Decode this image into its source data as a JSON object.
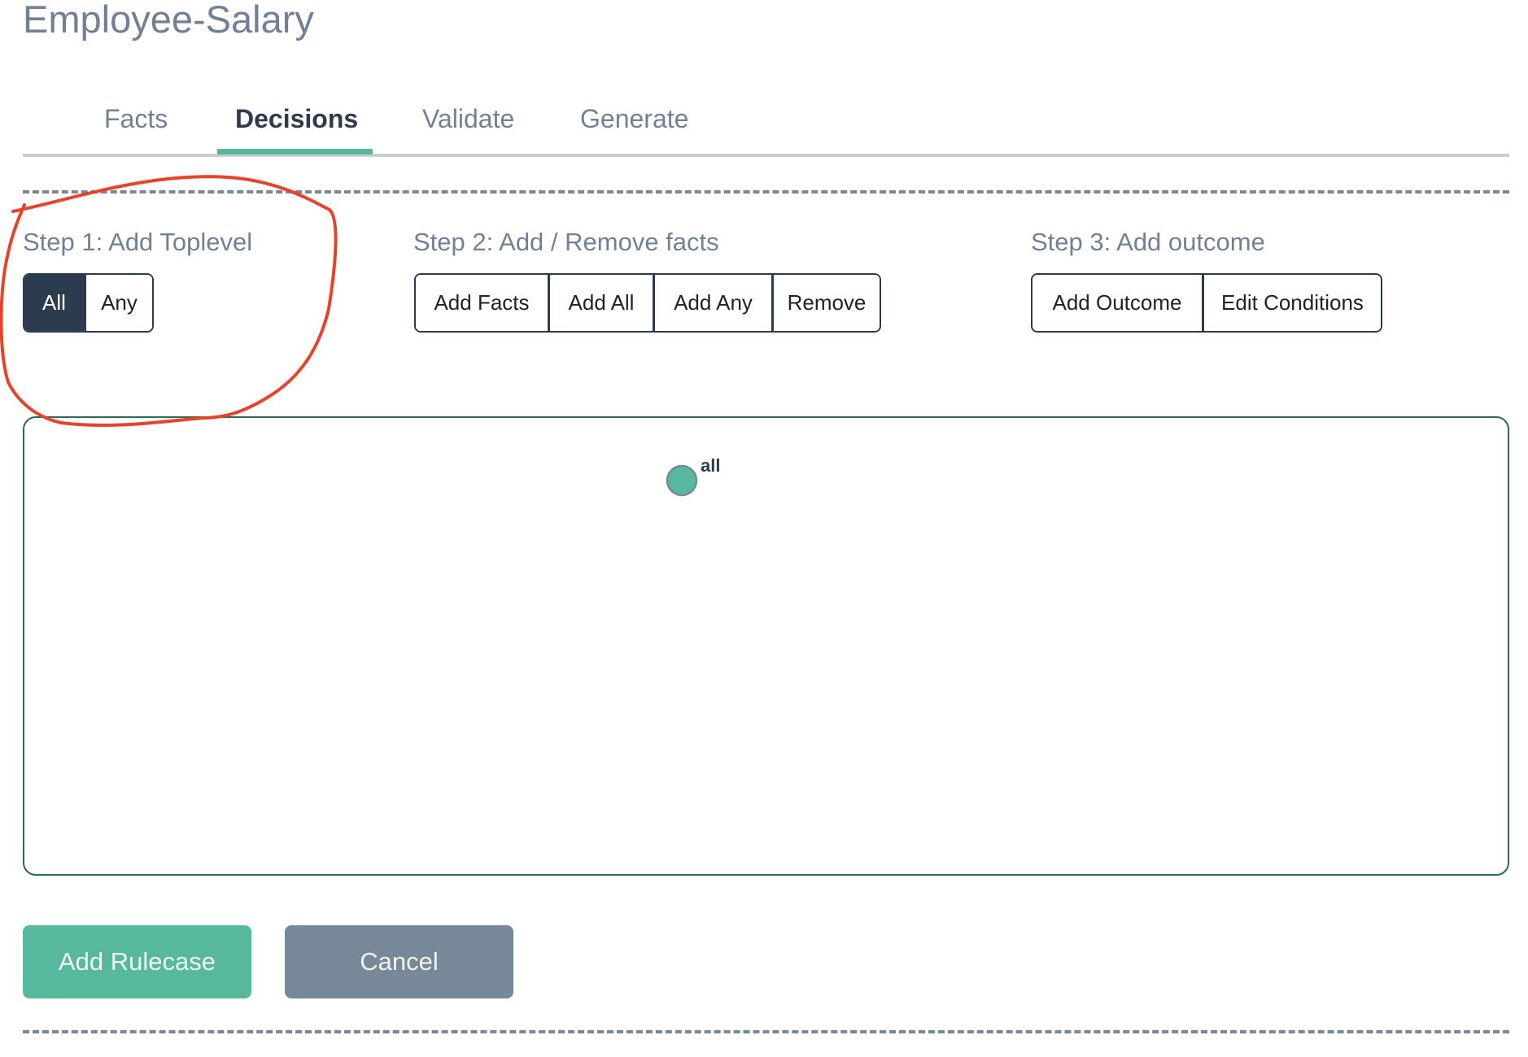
{
  "header": {
    "title": "Employee-Salary"
  },
  "tabs": [
    {
      "label": "Facts",
      "active": false
    },
    {
      "label": "Decisions",
      "active": true
    },
    {
      "label": "Validate",
      "active": false
    },
    {
      "label": "Generate",
      "active": false
    }
  ],
  "steps": {
    "step1": {
      "label": "Step 1: Add Toplevel",
      "buttons": [
        {
          "label": "All",
          "selected": true
        },
        {
          "label": "Any",
          "selected": false
        }
      ]
    },
    "step2": {
      "label": "Step 2: Add / Remove facts",
      "buttons": [
        {
          "label": "Add Facts"
        },
        {
          "label": "Add All"
        },
        {
          "label": "Add Any"
        },
        {
          "label": "Remove"
        }
      ]
    },
    "step3": {
      "label": "Step 3: Add outcome",
      "buttons": [
        {
          "label": "Add Outcome"
        },
        {
          "label": "Edit Conditions"
        }
      ]
    }
  },
  "graph": {
    "nodes": [
      {
        "label": "all",
        "color": "#56b99d"
      }
    ]
  },
  "actions": {
    "add_rulecase": "Add Rulecase",
    "cancel": "Cancel"
  },
  "colors": {
    "accent": "#56b99d",
    "dark": "#2d3b4f",
    "muted": "#778899",
    "annotation": "#e8432a"
  }
}
